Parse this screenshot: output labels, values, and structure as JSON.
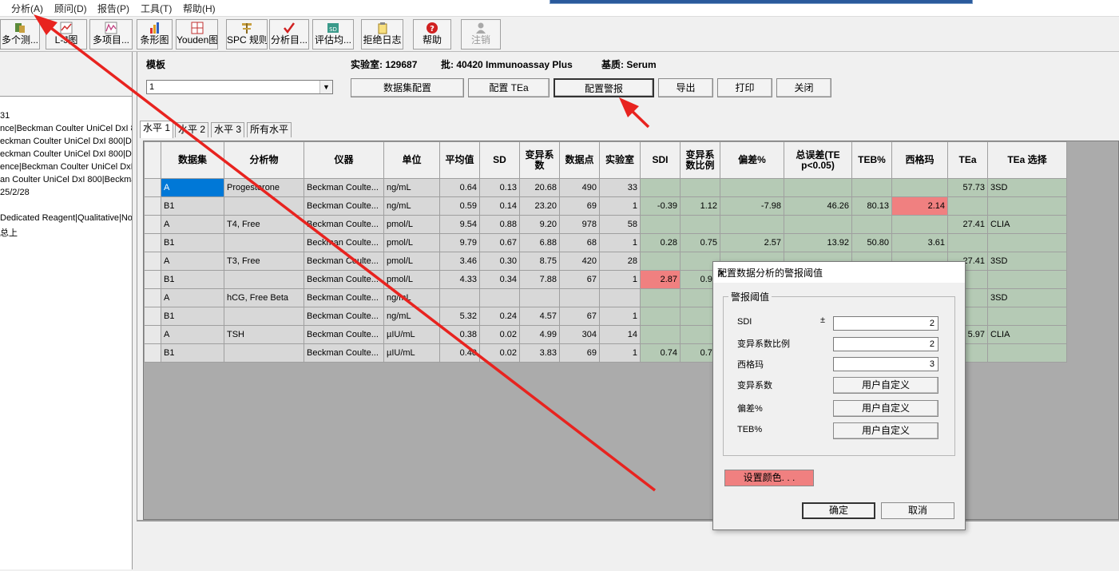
{
  "menu": [
    "分析(A)",
    "顾问(D)",
    "报告(P)",
    "工具(T)",
    "帮助(H)"
  ],
  "toolbar": [
    {
      "label": "多个测...",
      "icon": "multi-test-icon"
    },
    {
      "label": "L-J图",
      "icon": "lj-chart-icon"
    },
    {
      "label": "多项目...",
      "icon": "multi-item-icon"
    },
    {
      "label": "条形图",
      "icon": "bar-chart-icon"
    },
    {
      "label": "Youden图",
      "icon": "youden-icon"
    },
    {
      "label": "SPC 规则",
      "icon": "spc-rule-icon"
    },
    {
      "label": "分析目...",
      "icon": "analysis-target-icon"
    },
    {
      "label": "评估均...",
      "icon": "sd-eval-icon"
    },
    {
      "label": "拒绝日志",
      "icon": "reject-log-icon"
    },
    {
      "label": "帮助",
      "icon": "help-icon"
    },
    {
      "label": "注销",
      "icon": "logout-icon"
    }
  ],
  "left_panel": {
    "lines": [
      "31",
      "nce|Beckman Coulter UniCel DxI 80",
      "eckman Coulter UniCel DxI 800|De",
      "eckman Coulter UniCel DxI 800|De",
      "ence|Beckman Coulter UniCel DxI",
      "an Coulter UniCel DxI 800|Beckma",
      "25/2/28",
      "",
      "Dedicated Reagent|Qualitative|No",
      "总上"
    ]
  },
  "header": {
    "template_label": "模板",
    "lab_label": "实验室: 129687",
    "lot_label": "批: 40420  Immunoassay Plus",
    "matrix_label": "基质:   Serum",
    "level_value": "1"
  },
  "actions": [
    "数据集配置",
    "配置 TEa",
    "配置警报",
    "导出",
    "打印",
    "关闭"
  ],
  "tabs": [
    "水平 1",
    "水平 2",
    "水平 3",
    "所有水平"
  ],
  "table": {
    "columns": [
      "数据集",
      "分析物",
      "仪器",
      "单位",
      "平均值",
      "SD",
      "变异系数",
      "数据点",
      "实验室",
      "SDI",
      "变异系数比例",
      "偏差%",
      "总误差(TE p<0.05)",
      "TEB%",
      "西格玛",
      "TEa",
      "TEa 选择"
    ],
    "rows": [
      [
        "A",
        "Progesterone",
        "Beckman Coulte...",
        "ng/mL",
        "0.64",
        "0.13",
        "20.68",
        "490",
        "33",
        "",
        "",
        "",
        "",
        "",
        "",
        "57.73",
        "3SD"
      ],
      [
        "B1",
        "",
        "Beckman Coulte...",
        "ng/mL",
        "0.59",
        "0.14",
        "23.20",
        "69",
        "1",
        "-0.39",
        "1.12",
        "-7.98",
        "46.26",
        "80.13",
        "2.14",
        "",
        ""
      ],
      [
        "A",
        "T4, Free",
        "Beckman Coulte...",
        "pmol/L",
        "9.54",
        "0.88",
        "9.20",
        "978",
        "58",
        "",
        "",
        "",
        "",
        "",
        "",
        "27.41",
        "CLIA"
      ],
      [
        "B1",
        "",
        "Beckman Coulte...",
        "pmol/L",
        "9.79",
        "0.67",
        "6.88",
        "68",
        "1",
        "0.28",
        "0.75",
        "2.57",
        "13.92",
        "50.80",
        "3.61",
        "",
        ""
      ],
      [
        "A",
        "T3, Free",
        "Beckman Coulte...",
        "pmol/L",
        "3.46",
        "0.30",
        "8.75",
        "420",
        "28",
        "",
        "",
        "",
        "",
        "",
        "",
        "27.41",
        "3SD"
      ],
      [
        "B1",
        "",
        "Beckman Coulte...",
        "pmol/L",
        "4.33",
        "0.34",
        "7.88",
        "67",
        "1",
        "2.87",
        "0.90",
        "",
        "",
        "",
        "",
        "",
        ""
      ],
      [
        "A",
        "hCG, Free Beta",
        "Beckman Coulte...",
        "ng/mL",
        "",
        "",
        "",
        "",
        "",
        "",
        "",
        "",
        "",
        "",
        "",
        "",
        "3SD"
      ],
      [
        "B1",
        "",
        "Beckman Coulte...",
        "ng/mL",
        "5.32",
        "0.24",
        "4.57",
        "67",
        "1",
        "",
        "",
        "",
        "",
        "",
        "",
        "",
        ""
      ],
      [
        "A",
        "TSH",
        "Beckman Coulte...",
        "µIU/mL",
        "0.38",
        "0.02",
        "4.99",
        "304",
        "14",
        "",
        "",
        "",
        "",
        "",
        "",
        "5.97",
        "CLIA"
      ],
      [
        "B1",
        "",
        "Beckman Coulte...",
        "µIU/mL",
        "0.40",
        "0.02",
        "3.83",
        "69",
        "1",
        "0.74",
        "0.77",
        "",
        "",
        "",
        "",
        "",
        ""
      ]
    ]
  },
  "dialog": {
    "title": "配置数据分析的警报阈值",
    "group_label": "警报阈值",
    "sdi_label": "SDI",
    "sdi_pm": "±",
    "sdi_value": "2",
    "cvr_label": "变异系数比例",
    "cvr_value": "2",
    "sigma_label": "西格玛",
    "sigma_value": "3",
    "cv_label": "变异系数",
    "cv_button": "用户自定义",
    "bias_label": "偏差%",
    "bias_button": "用户自定义",
    "teb_label": "TEB%",
    "teb_button": "用户自定义",
    "color_button": "设置颜色. . .",
    "ok": "确定",
    "cancel": "取消"
  },
  "colors": {
    "alert_red": "#f08080",
    "cell_green": "#b5cab5",
    "annotation_red": "#e8231f"
  }
}
